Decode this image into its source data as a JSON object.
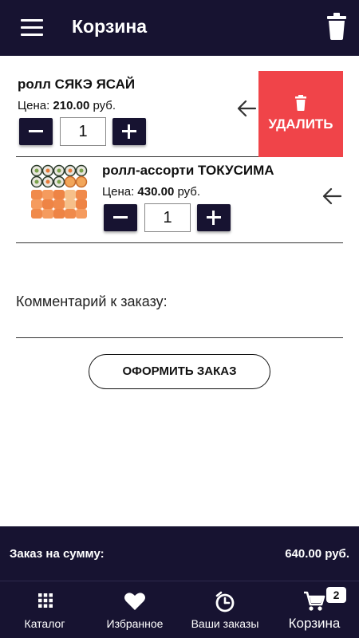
{
  "appbar": {
    "title": "Корзина",
    "menu_icon": "menu-icon",
    "clear_icon": "trash-icon"
  },
  "cart": {
    "items": [
      {
        "name": "ролл СЯКЭ ЯСАЙ",
        "price_label": "Цена:",
        "price": "210.00",
        "currency": "руб.",
        "quantity": "1",
        "has_image": false
      },
      {
        "name": "ролл-ассорти ТОКУСИМА",
        "price_label": "Цена:",
        "price": "430.00",
        "currency": "руб.",
        "quantity": "1",
        "has_image": true
      }
    ],
    "delete_label": "УДАЛИТЬ"
  },
  "comment": {
    "label": "Комментарий к заказу:"
  },
  "order_button": "ОФОРМИТЬ ЗАКАЗ",
  "summary": {
    "label": "Заказ на сумму:",
    "value": "640.00 руб."
  },
  "bottom_nav": {
    "items": [
      {
        "label": "Каталог",
        "icon": "grid-icon"
      },
      {
        "label": "Избранное",
        "icon": "heart-icon"
      },
      {
        "label": "Ваши заказы",
        "icon": "orders-icon"
      },
      {
        "label": "Корзина",
        "icon": "cart-icon",
        "badge": "2"
      }
    ]
  },
  "colors": {
    "primary_dark": "#171331",
    "delete_red": "#f04449",
    "white": "#ffffff"
  }
}
